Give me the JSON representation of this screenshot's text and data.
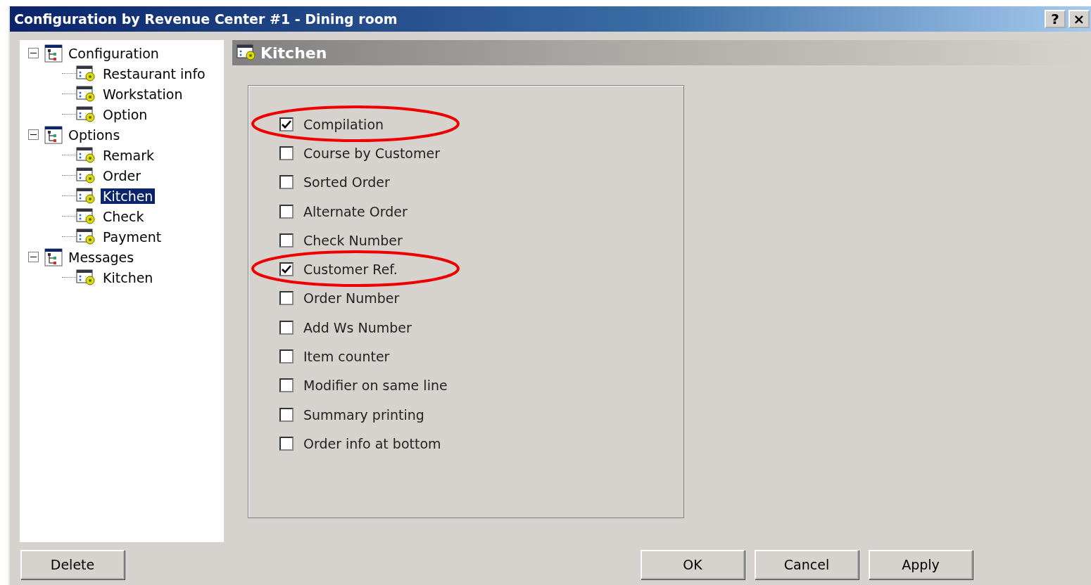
{
  "window": {
    "title": "Configuration by Revenue Center #1 - Dining room",
    "buttons": [
      "?",
      "×"
    ]
  },
  "tree": [
    {
      "label": "Configuration",
      "expanded": true,
      "selected": false,
      "children": [
        {
          "label": "Restaurant info",
          "selected": false
        },
        {
          "label": "Workstation",
          "selected": false
        },
        {
          "label": "Option",
          "selected": false
        }
      ]
    },
    {
      "label": "Options",
      "expanded": true,
      "selected": false,
      "children": [
        {
          "label": "Remark",
          "selected": false
        },
        {
          "label": "Order",
          "selected": false
        },
        {
          "label": "Kitchen",
          "selected": true
        },
        {
          "label": "Check",
          "selected": false
        },
        {
          "label": "Payment",
          "selected": false
        }
      ]
    },
    {
      "label": "Messages",
      "expanded": true,
      "selected": false,
      "children": [
        {
          "label": "Kitchen",
          "selected": false
        }
      ]
    }
  ],
  "panel": {
    "title": "Kitchen"
  },
  "options": [
    {
      "label": "Compilation",
      "checked": true,
      "circled": true
    },
    {
      "label": "Course by Customer",
      "checked": false,
      "circled": false
    },
    {
      "label": "Sorted Order",
      "checked": false,
      "circled": false
    },
    {
      "label": "Alternate Order",
      "checked": false,
      "circled": false
    },
    {
      "label": "Check Number",
      "checked": false,
      "circled": false
    },
    {
      "label": "Customer Ref.",
      "checked": true,
      "circled": true
    },
    {
      "label": "Order Number",
      "checked": false,
      "circled": false
    },
    {
      "label": "Add Ws Number",
      "checked": false,
      "circled": false
    },
    {
      "label": "Item counter",
      "checked": false,
      "circled": false
    },
    {
      "label": "Modifier on same line",
      "checked": false,
      "circled": false
    },
    {
      "label": "Summary printing",
      "checked": false,
      "circled": false
    },
    {
      "label": "Order info at bottom",
      "checked": false,
      "circled": false
    }
  ],
  "left_buttons": [
    "Delete"
  ],
  "right_buttons": [
    "OK",
    "Cancel",
    "Apply"
  ]
}
